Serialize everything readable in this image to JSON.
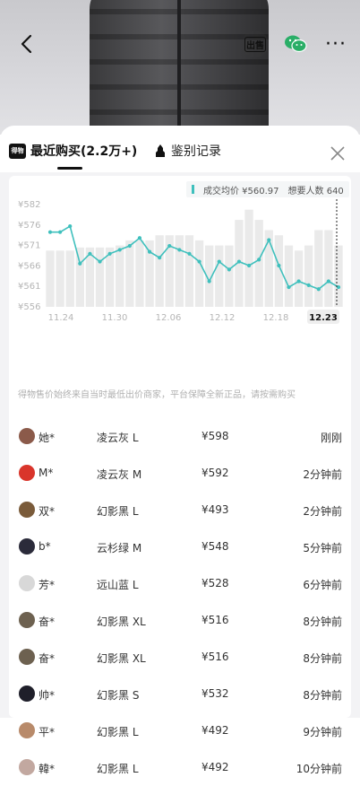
{
  "colors": {
    "accent": "#3fc0bd",
    "bars": "#eaeaea",
    "text": "#333333"
  },
  "header": {
    "back_icon": "back-arrow-icon",
    "sell_label": "出售",
    "wechat_icon": "wechat-icon",
    "more_label": "···"
  },
  "tabs": [
    {
      "label": "最近购买(2.2万+)",
      "logo": "得物",
      "active": true
    },
    {
      "label": "鉴别记录",
      "icon": "auth-icon",
      "active": false
    }
  ],
  "chart_legend": {
    "avg_label": "成交均价 ¥560.97",
    "wants_label": "想要人数 640"
  },
  "chart_data": {
    "type": "line",
    "y_ticks": [
      "¥582",
      "¥576",
      "¥571",
      "¥566",
      "¥561",
      "¥556"
    ],
    "ylim": [
      556,
      582
    ],
    "x_ticks": [
      "11.24",
      "11.30",
      "12.06",
      "12.12",
      "12.18",
      "12.23"
    ],
    "x_highlight": "12.23",
    "series": [
      {
        "values": [
          575,
          575,
          576.5,
          567,
          569.5,
          567.5,
          569.5,
          570.5,
          571.5,
          573.5,
          570,
          568.5,
          571.5,
          570.5,
          569.5,
          567.5,
          562.5,
          567.5,
          565.5,
          567.5,
          566.5,
          568,
          573,
          566.5,
          561,
          562.5,
          561.5,
          560.5,
          562.5,
          561
        ]
      }
    ],
    "bars_wants_ratio": [
      0.55,
      0.55,
      0.55,
      0.58,
      0.58,
      0.58,
      0.58,
      0.6,
      0.65,
      0.65,
      0.65,
      0.7,
      0.7,
      0.7,
      0.7,
      0.65,
      0.6,
      0.6,
      0.6,
      0.85,
      0.95,
      0.85,
      0.75,
      0.7,
      0.6,
      0.55,
      0.6,
      0.75,
      0.75,
      0.6
    ]
  },
  "notice": "得物售价始终来自当时最低出价商家，平台保障全新正品，请按需购买",
  "purchases": [
    {
      "name": "她*",
      "sku": "凌云灰 L",
      "price": "¥598",
      "time": "刚刚",
      "avatar": "#8b5a4a"
    },
    {
      "name": "M*",
      "sku": "凌云灰 M",
      "price": "¥592",
      "time": "2分钟前",
      "avatar": "#d9352b"
    },
    {
      "name": "双*",
      "sku": "幻影黑 L",
      "price": "¥493",
      "time": "2分钟前",
      "avatar": "#7a5b3a"
    },
    {
      "name": "b*",
      "sku": "云杉绿 M",
      "price": "¥548",
      "time": "5分钟前",
      "avatar": "#2b2b3a"
    },
    {
      "name": "芳*",
      "sku": "远山蓝 L",
      "price": "¥528",
      "time": "6分钟前",
      "avatar": "#d8d8d8"
    },
    {
      "name": "奋*",
      "sku": "幻影黑 XL",
      "price": "¥516",
      "time": "8分钟前",
      "avatar": "#6d6150"
    },
    {
      "name": "奋*",
      "sku": "幻影黑 XL",
      "price": "¥516",
      "time": "8分钟前",
      "avatar": "#6d6150"
    },
    {
      "name": "帅*",
      "sku": "幻影黑 S",
      "price": "¥532",
      "time": "8分钟前",
      "avatar": "#1f1f2a"
    },
    {
      "name": "平*",
      "sku": "幻影黑 L",
      "price": "¥492",
      "time": "9分钟前",
      "avatar": "#b88a6a"
    },
    {
      "name": "韓*",
      "sku": "幻影黑 L",
      "price": "¥492",
      "time": "10分钟前",
      "avatar": "#c2a8a0"
    }
  ]
}
